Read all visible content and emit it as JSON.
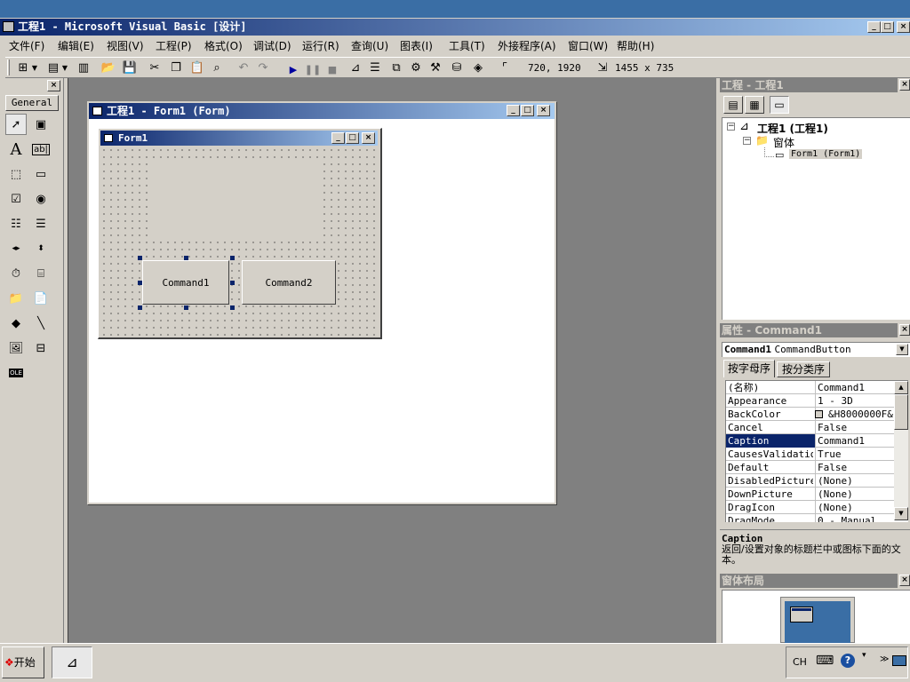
{
  "window": {
    "title": "工程1 - Microsoft Visual Basic [设计]"
  },
  "menu": [
    "文件(F)",
    "编辑(E)",
    "视图(V)",
    "工程(P)",
    "格式(O)",
    "调试(D)",
    "运行(R)",
    "查询(U)",
    "图表(I)",
    "工具(T)",
    "外接程序(A)",
    "窗口(W)",
    "帮助(H)"
  ],
  "toolbar": {
    "position": "720, 1920",
    "size": "1455 x 735"
  },
  "toolbox": {
    "tab": "General",
    "tools": [
      "pointer-icon",
      "picturebox-icon",
      "label-icon",
      "textbox-icon",
      "frame-icon",
      "commandbutton-icon",
      "checkbox-icon",
      "optionbutton-icon",
      "combobox-icon",
      "listbox-icon",
      "hscrollbar-icon",
      "vscrollbar-icon",
      "timer-icon",
      "drivelistbox-icon",
      "dirlistbox-icon",
      "filelistbox-icon",
      "shape-icon",
      "line-icon",
      "image-icon",
      "data-icon",
      "ole-icon"
    ]
  },
  "designer": {
    "title": "工程1 - Form1 (Form)",
    "form_title": "Form1",
    "command1": "Command1",
    "command2": "Command2"
  },
  "project": {
    "title": "工程 - 工程1",
    "root": "工程1 (工程1)",
    "folder": "窗体",
    "form": "Form1 (Form1)"
  },
  "properties": {
    "title": "属性 - Command1",
    "object_name": "Command1",
    "object_type": "CommandButton",
    "tab_alpha": "按字母序",
    "tab_category": "按分类序",
    "rows": [
      {
        "name": "(名称)",
        "value": "Command1"
      },
      {
        "name": "Appearance",
        "value": "1 - 3D"
      },
      {
        "name": "BackColor",
        "value": "&H8000000F&"
      },
      {
        "name": "Cancel",
        "value": "False"
      },
      {
        "name": "Caption",
        "value": "Command1"
      },
      {
        "name": "CausesValidation",
        "value": "True"
      },
      {
        "name": "Default",
        "value": "False"
      },
      {
        "name": "DisabledPicture",
        "value": "(None)"
      },
      {
        "name": "DownPicture",
        "value": "(None)"
      },
      {
        "name": "DragIcon",
        "value": "(None)"
      },
      {
        "name": "DragMode",
        "value": "0 - Manual"
      }
    ],
    "selected_row": 4,
    "desc_title": "Caption",
    "desc_text": "返回/设置对象的标题栏中或图标下面的文本。"
  },
  "layout": {
    "title": "窗体布局"
  },
  "taskbar": {
    "start": "开始",
    "lang": "CH"
  },
  "colors": {
    "face": "#d4d0c8",
    "title_active": "#0a246a",
    "selection": "#0a246a",
    "mdi_bg": "#808080"
  }
}
